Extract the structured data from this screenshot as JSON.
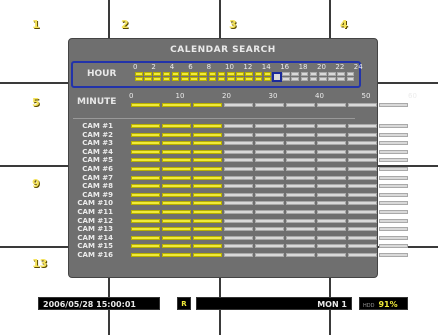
{
  "cells": [
    "1",
    "2",
    "3",
    "4",
    "5",
    "9",
    "13"
  ],
  "panel": {
    "title": "CALENDAR SEARCH",
    "hour_label": "HOUR",
    "minute_label": "MINUTE",
    "hour_ticks": [
      "0",
      "2",
      "4",
      "6",
      "8",
      "10",
      "12",
      "14",
      "16",
      "18",
      "20",
      "22",
      "24"
    ],
    "minute_ticks": [
      "0",
      "10",
      "20",
      "30",
      "40",
      "50",
      "60"
    ],
    "hours_recorded": 15,
    "hour_cursor": 15,
    "minutes_recorded": 3,
    "cameras": [
      "CAM #1",
      "CAM #2",
      "CAM #3",
      "CAM #4",
      "CAM #5",
      "CAM #6",
      "CAM #7",
      "CAM #8",
      "CAM #9",
      "CAM #10",
      "CAM #11",
      "CAM #12",
      "CAM #13",
      "CAM #14",
      "CAM #15",
      "CAM #16"
    ],
    "camera_minutes_recorded": 3
  },
  "status": {
    "datetime": "2006/05/28 15:00:01",
    "rec": "R",
    "monitor": "MON 1",
    "hdd_label": "HDD",
    "hdd_percent": "91%"
  },
  "colors": {
    "recorded": "#f0ea3a",
    "empty": "#d9d9d9",
    "accent": "#2233aa"
  }
}
